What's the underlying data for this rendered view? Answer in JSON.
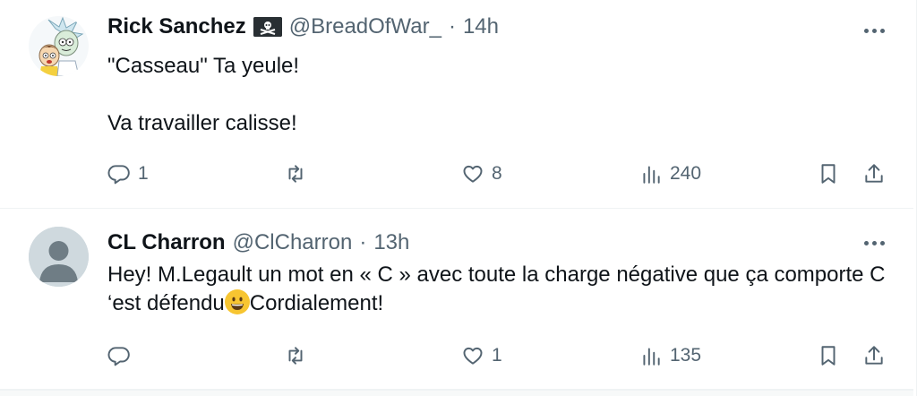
{
  "tweets": [
    {
      "name": "Rick Sanchez",
      "handle": "@BreadOfWar_",
      "separator": "·",
      "time": "14h",
      "avatar_icon": "cartoon-avatar",
      "name_badge_icon": "pirate-flag-icon",
      "paragraphs": [
        "\"Casseau\" Ta yeule!",
        "Va travailler calisse!"
      ],
      "actions": {
        "replies": "1",
        "retweets": "",
        "likes": "8",
        "views": "240"
      }
    },
    {
      "name": "CL Charron",
      "handle": "@ClCharron",
      "separator": "·",
      "time": "13h",
      "avatar_icon": "default-avatar",
      "text_before_emoji": "Hey! M.Legault un mot en « C » avec toute la charge négative que ça comporte C ‘est défendu",
      "emoji_icon": "grinning-face-emoji",
      "text_after_emoji": "Cordialement!",
      "actions": {
        "replies": "",
        "retweets": "",
        "likes": "1",
        "views": "135"
      }
    }
  ],
  "colors": {
    "text": "#0f1419",
    "secondary": "#536471",
    "divider": "#eff3f4"
  }
}
